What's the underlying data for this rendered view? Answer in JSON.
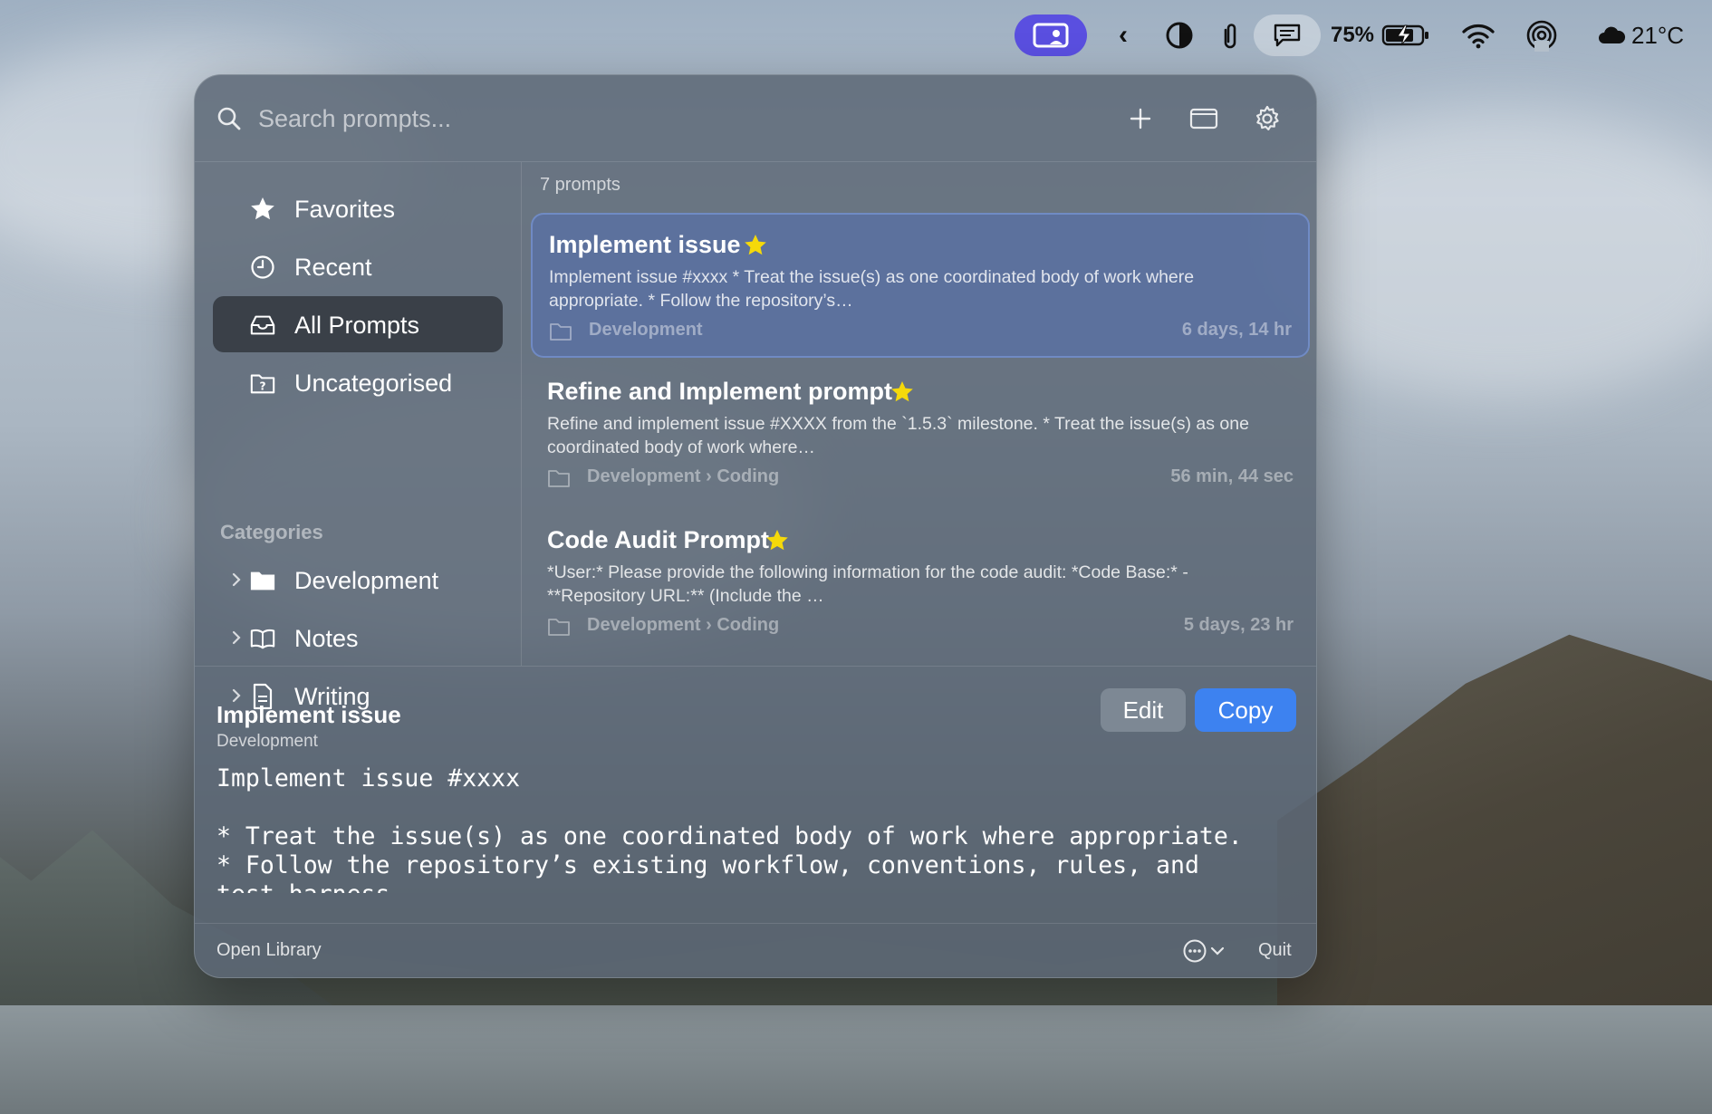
{
  "menubar": {
    "battery_percent": "75%",
    "weather": "21°C"
  },
  "search": {
    "placeholder": "Search prompts..."
  },
  "sidebar": {
    "items": [
      {
        "label": "Favorites"
      },
      {
        "label": "Recent"
      },
      {
        "label": "All Prompts"
      },
      {
        "label": "Uncategorised"
      }
    ],
    "categories_header": "Categories",
    "categories": [
      {
        "label": "Development"
      },
      {
        "label": "Notes"
      },
      {
        "label": "Writing"
      }
    ]
  },
  "list": {
    "count": "7 prompts",
    "prompts": [
      {
        "title": "Implement issue",
        "snippet": "Implement issue #xxxx  * Treat the issue(s) as one coordinated body of work where appropriate. * Follow the repository’s…",
        "category": "Development",
        "time": "6 days, 14 hr"
      },
      {
        "title": "Refine and Implement prompt",
        "snippet": "Refine and implement issue #XXXX from the `1.5.3` milestone.  * Treat the issue(s) as one coordinated body of work where…",
        "category": "Development › Coding",
        "time": "56 min, 44 sec"
      },
      {
        "title": "Code Audit Prompt",
        "snippet": "*User:* Please provide the following information for the code audit:  *Code Base:*   - **Repository URL:** (Include the …",
        "category": "Development › Coding",
        "time": "5 days, 23 hr"
      }
    ]
  },
  "detail": {
    "title": "Implement issue",
    "category": "Development",
    "edit_label": "Edit",
    "copy_label": "Copy",
    "body": "Implement issue #xxxx\n\n* Treat the issue(s) as one coordinated body of work where appropriate.\n* Follow the repository’s existing workflow, conventions, rules, and\ntest harness."
  },
  "footer": {
    "open_library": "Open Library",
    "quit": "Quit"
  },
  "colors": {
    "accent": "#3d82f0",
    "star": "#f5d90a",
    "menubar_app": "#5a4fe0"
  }
}
